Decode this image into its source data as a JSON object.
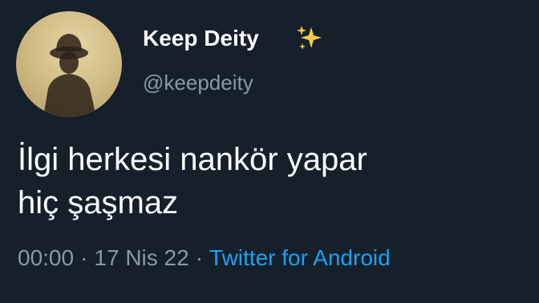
{
  "user": {
    "display_name": "Keep Deity",
    "name_emoji": "sparkles-icon",
    "handle": "@keepdeity"
  },
  "tweet": {
    "lines": [
      "İlgi herkesi nankör yapar",
      "hiç şaşmaz"
    ]
  },
  "meta": {
    "time": "00:00",
    "date": "17 Nis 22",
    "separator": "·",
    "source": "Twitter for Android"
  },
  "colors": {
    "background": "#15202b",
    "text_primary": "#ffffff",
    "text_secondary": "#8899a6",
    "accent": "#1da1f2",
    "sparkles": "#f7c948"
  }
}
